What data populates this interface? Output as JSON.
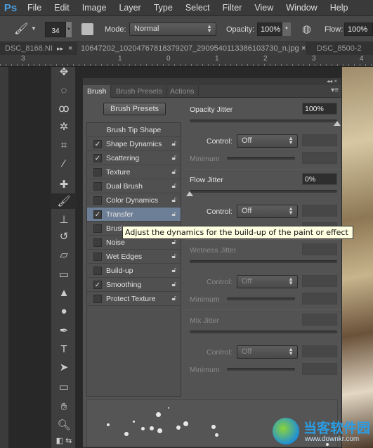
{
  "app": {
    "logo": "Ps"
  },
  "menu": [
    "File",
    "Edit",
    "Image",
    "Layer",
    "Type",
    "Select",
    "Filter",
    "View",
    "Window",
    "Help"
  ],
  "options": {
    "brush_size": "34",
    "mode_label": "Mode:",
    "mode_value": "Normal",
    "opacity_label": "Opacity:",
    "opacity_value": "100%",
    "flow_label": "Flow:",
    "flow_value": "100%"
  },
  "doc_tabs": [
    {
      "label": "DSC_8168.NI"
    },
    {
      "label": "10647202_10204767818379207_2909540113386103730_n.jpg"
    },
    {
      "label": "DSC_8500-2"
    }
  ],
  "ruler_numbers": [
    "3",
    "1",
    "0",
    "1",
    "2",
    "3",
    "4"
  ],
  "panel": {
    "tabs": [
      "Brush",
      "Brush Presets",
      "Actions"
    ],
    "active_tab": "Brush",
    "presets_button": "Brush Presets",
    "tip_shape": "Brush Tip Shape",
    "items": [
      {
        "label": "Shape Dynamics",
        "checked": true
      },
      {
        "label": "Scattering",
        "checked": true
      },
      {
        "label": "Texture",
        "checked": false
      },
      {
        "label": "Dual Brush",
        "checked": false
      },
      {
        "label": "Color Dynamics",
        "checked": false
      },
      {
        "label": "Transfer",
        "checked": true,
        "selected": true
      },
      {
        "label": "Brush Pose",
        "checked": false
      },
      {
        "label": "Noise",
        "checked": false
      },
      {
        "label": "Wet Edges",
        "checked": false
      },
      {
        "label": "Build-up",
        "checked": false
      },
      {
        "label": "Smoothing",
        "checked": true
      },
      {
        "label": "Protect Texture",
        "checked": false
      }
    ],
    "sections": [
      {
        "title": "Opacity Jitter",
        "value": "100%",
        "slider": 100,
        "enabled": true,
        "control_label": "Control:",
        "control": "Off",
        "minimum_label": "Minimum"
      },
      {
        "title": "Flow Jitter",
        "value": "0%",
        "slider": 0,
        "enabled": true,
        "control_label": "Control:",
        "control": "Off",
        "minimum_label": "Minimum"
      },
      {
        "title": "Wetness Jitter",
        "value": "",
        "enabled": false,
        "control_label": "Control:",
        "control": "Off",
        "minimum_label": "Minimum"
      },
      {
        "title": "Mix Jitter",
        "value": "",
        "enabled": false,
        "control_label": "Control:",
        "control": "Off",
        "minimum_label": "Minimum"
      }
    ]
  },
  "tooltip": "Adjust the dynamics for the build-up of the paint or effect",
  "watermark": {
    "text": "当客软件园",
    "url": "www.downkr.com"
  }
}
